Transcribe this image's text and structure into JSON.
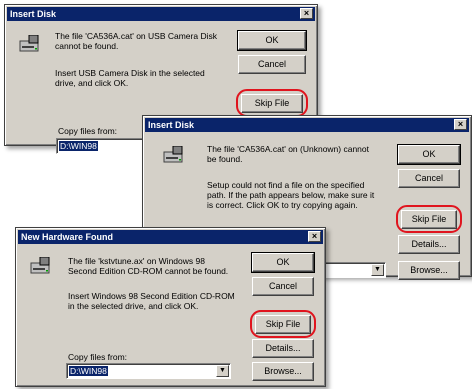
{
  "dialog1": {
    "title": "Insert Disk",
    "message": "The file 'CA536A.cat' on USB Camera Disk\ncannot be found.",
    "instruction": "Insert USB Camera Disk in the selected\ndrive, and click OK.",
    "ok_label": "OK",
    "cancel_label": "Cancel",
    "skip_label": "Skip File",
    "copy_label": "Copy files from:",
    "copy_value": "D:\\WIN98"
  },
  "dialog2": {
    "title": "Insert Disk",
    "message": "The file 'CA536A.cat' on (Unknown) cannot\nbe found.",
    "instruction": "Setup could not find a file on the specified\npath. If the path appears below, make sure it\nis correct. Click OK to try copying again.",
    "ok_label": "OK",
    "cancel_label": "Cancel",
    "skip_label": "Skip File",
    "details_label": "Details...",
    "browse_label": "Browse..."
  },
  "dialog3": {
    "title": "New Hardware Found",
    "message": "The file 'kstvtune.ax' on Windows 98\nSecond Edition CD-ROM cannot be found.",
    "instruction": "Insert Windows 98 Second Edition CD-ROM\nin the selected drive, and click OK.",
    "ok_label": "OK",
    "cancel_label": "Cancel",
    "skip_label": "Skip File",
    "details_label": "Details...",
    "copy_label": "Copy files from:",
    "copy_value": "D:\\WIN98",
    "browse_label": "Browse..."
  },
  "colors": {
    "titlebar": "#0a246a",
    "face": "#d4d0c8",
    "highlight_ring": "#e0141e"
  },
  "icons": [
    "disk-drive-icon",
    "close-icon",
    "dropdown-arrow-icon"
  ]
}
